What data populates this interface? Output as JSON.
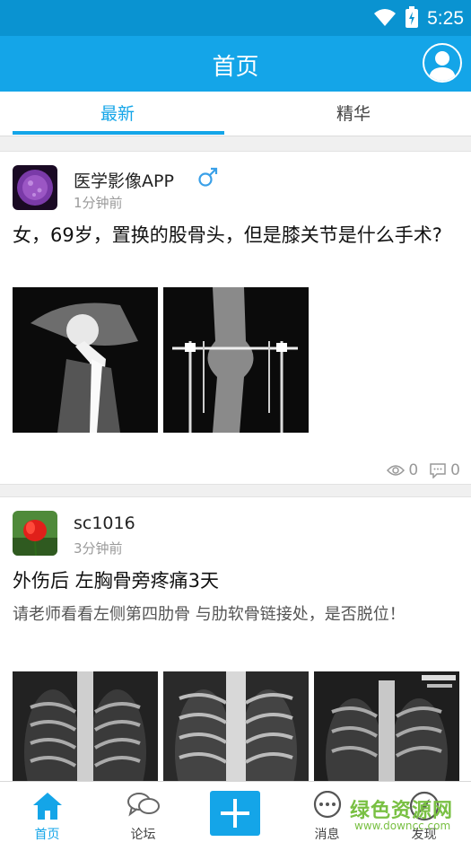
{
  "status_bar": {
    "time": "5:25"
  },
  "app_bar": {
    "title": "首页"
  },
  "tabs": [
    {
      "label": "最新",
      "active": true
    },
    {
      "label": "精华",
      "active": false
    }
  ],
  "posts": [
    {
      "username": "医学影像APP",
      "gender_icon": "male-icon",
      "time_ago": "1分钟前",
      "title": "女，69岁，置换的股骨头，但是膝关节是什么手术?",
      "description": "",
      "images": [
        "hip-xray",
        "knee-xray"
      ],
      "views": "0",
      "comments": "0"
    },
    {
      "username": "sc1016",
      "time_ago": "3分钟前",
      "title": "外伤后  左胸骨旁疼痛3天",
      "description": "请老师看看左侧第四肋骨  与肋软骨链接处，是否脱位！",
      "images": [
        "chest-xray-1",
        "chest-xray-2",
        "chest-xray-3"
      ]
    }
  ],
  "bottom_nav": [
    {
      "label": "首页",
      "icon": "home-icon",
      "active": true
    },
    {
      "label": "论坛",
      "icon": "forum-icon"
    },
    {
      "label": "",
      "icon": "add-icon"
    },
    {
      "label": "消息",
      "icon": "message-icon"
    },
    {
      "label": "发现",
      "icon": "discover-icon"
    }
  ],
  "watermark": {
    "text": "绿色资源网",
    "url": "www.downcc.com"
  },
  "colors": {
    "primary": "#14a5e8",
    "status_bar": "#0a93d1",
    "watermark": "#79c043"
  }
}
